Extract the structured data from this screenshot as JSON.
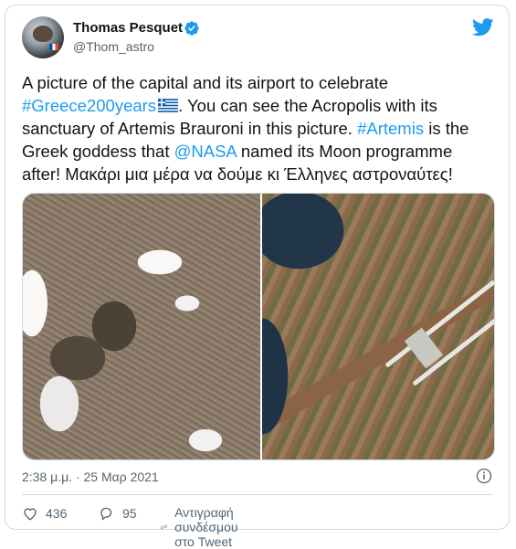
{
  "tweet": {
    "author_name": "Thomas Pesquet",
    "handle": "@Thom_astro",
    "text_part1": "A picture of the capital and its airport to celebrate\n",
    "hashtag1": "#Greece200years",
    "text_part2": ". You can see the Acropolis with its\nsanctuary of Artemis Brauroni in this picture. ",
    "hashtag2": "#Artemis",
    "text_part3": " is the\nGreek goddess that ",
    "mention": "@NASA",
    "text_part4": " named its Moon programme\nafter! Μακάρι μια μέρα να δούμε κι Έλληνες αστροναύτες!",
    "timestamp": "2:38 μ.μ. · 25 Μαρ 2021",
    "likes": "436",
    "replies": "95",
    "copy_link_label": "Αντιγραφή συνδέσμου στο Tweet"
  },
  "colors": {
    "link": "#1d9bf0",
    "verified": "#1d9bf0",
    "muted": "#536471",
    "border": "#cfd9de"
  },
  "icons": {
    "verified": "verified-badge-icon",
    "brand": "twitter-bird-icon",
    "info": "info-icon",
    "like": "heart-icon",
    "reply": "reply-bubble-icon",
    "link": "link-icon",
    "flag": "greek-flag-emoji"
  }
}
